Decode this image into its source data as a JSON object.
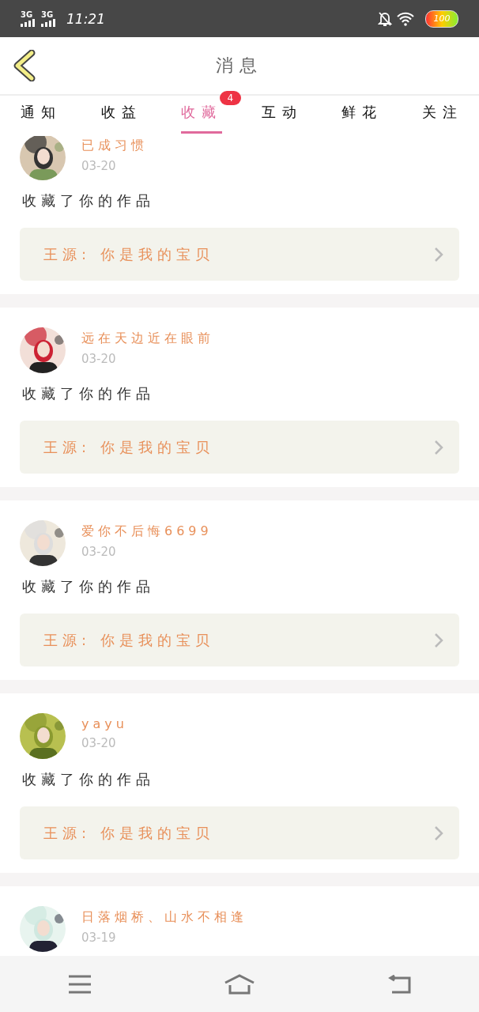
{
  "status_bar": {
    "signals": [
      "3G",
      "3G"
    ],
    "time": "11:21",
    "battery": "100"
  },
  "header": {
    "title": "消息"
  },
  "tabs": [
    {
      "label": "通知",
      "selected": false
    },
    {
      "label": "收益",
      "selected": false
    },
    {
      "label": "收藏",
      "selected": true,
      "badge": "4"
    },
    {
      "label": "互动",
      "selected": false
    },
    {
      "label": "鲜花",
      "selected": false
    },
    {
      "label": "关注",
      "selected": false
    }
  ],
  "messages": [
    {
      "name": "已成习惯",
      "date": "03-20",
      "action": "收藏了你的作品",
      "work": "王源: 你是我的宝贝"
    },
    {
      "name": "远在天边近在眼前",
      "date": "03-20",
      "action": "收藏了你的作品",
      "work": "王源: 你是我的宝贝"
    },
    {
      "name": "爱你不后悔6699",
      "date": "03-20",
      "action": "收藏了你的作品",
      "work": "王源: 你是我的宝贝"
    },
    {
      "name": "yayu",
      "date": "03-20",
      "action": "收藏了你的作品",
      "work": "王源: 你是我的宝贝"
    },
    {
      "name": "日落烟桥、山水不相逢",
      "date": "03-19"
    }
  ]
}
